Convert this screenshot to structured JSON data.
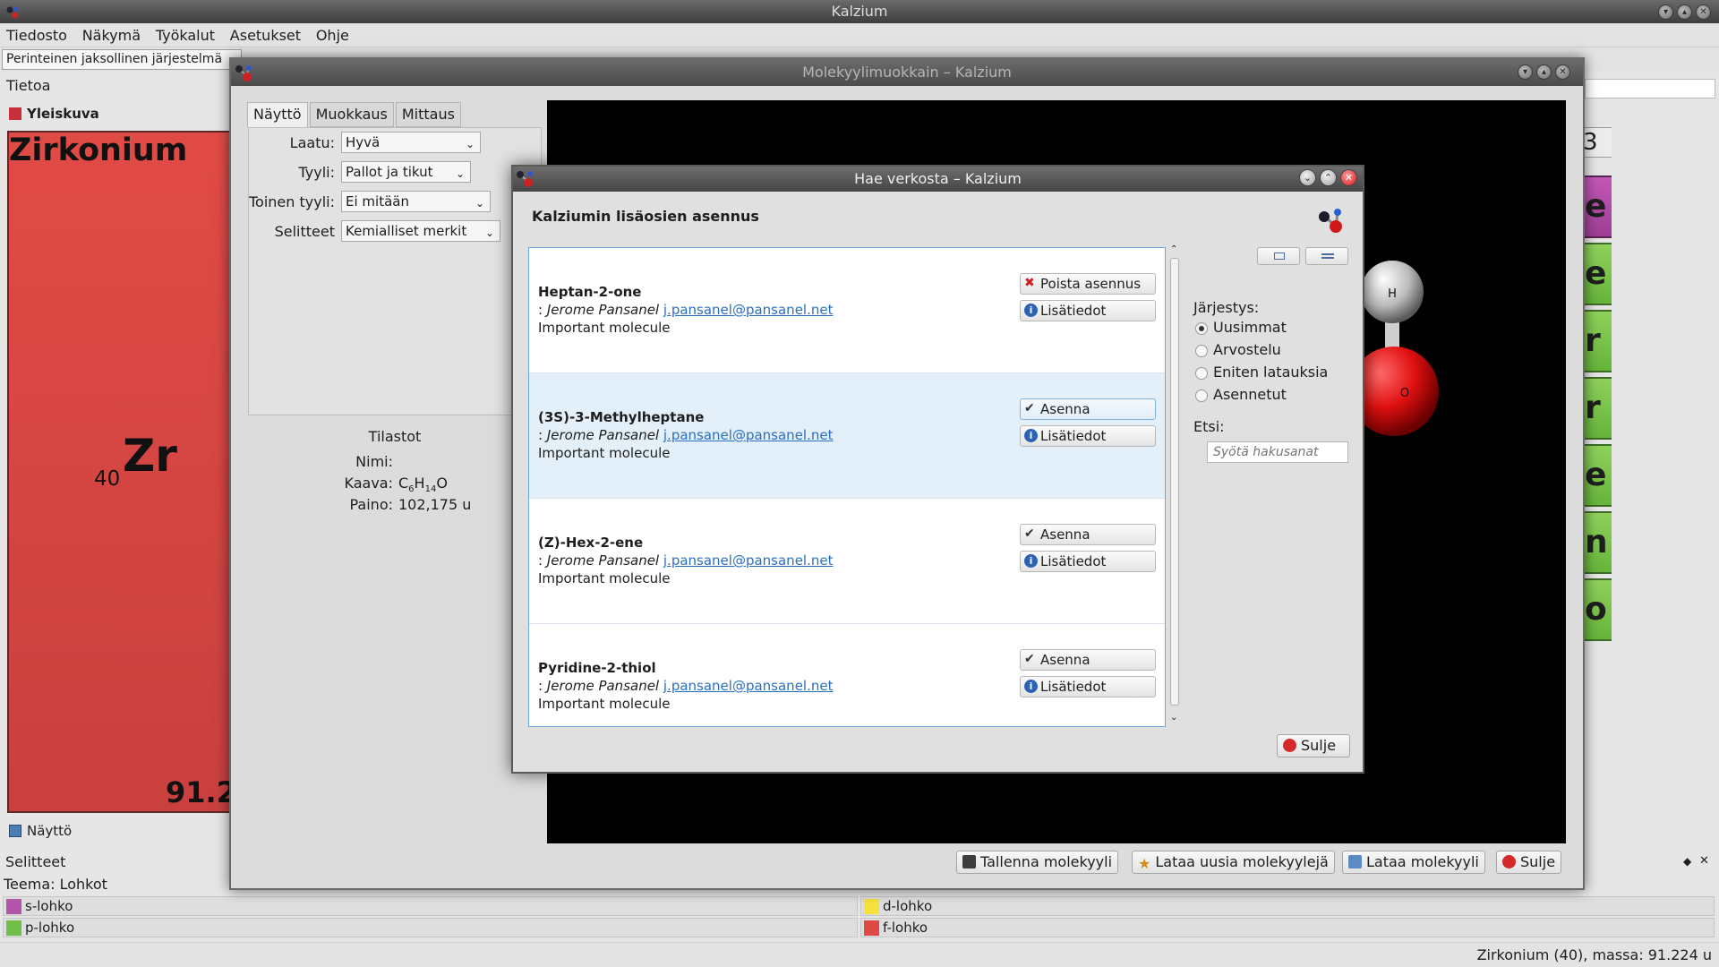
{
  "main_window": {
    "title": "Kalzium",
    "menu": [
      "Tiedosto",
      "Näkymä",
      "Työkalut",
      "Asetukset",
      "Ohje"
    ],
    "scheme_select": "Perinteinen jaksollinen järjestelmä",
    "info_header": "Tietoa",
    "overview_label": "Yleiskuva",
    "element": {
      "name": "Zirkonium",
      "number": "40",
      "symbol": "Zr",
      "mass": "91.2"
    },
    "view_dock_label": "Näyttö",
    "legend_title": "Selitteet",
    "theme_label": "Teema: Lohkot",
    "legend_items": [
      {
        "label": "s-lohko",
        "color": "#b455a9"
      },
      {
        "label": "d-lohko",
        "color": "#f5e23b"
      },
      {
        "label": "p-lohko",
        "color": "#6fbf4a"
      },
      {
        "label": "f-lohko",
        "color": "#de4a43"
      }
    ],
    "right_cells": [
      "e",
      "e",
      "r",
      "r",
      "e",
      "n",
      "o"
    ],
    "right_top_cell": "3",
    "status": "Zirkonium (40), massa: 91.224 u"
  },
  "molecule_editor": {
    "title": "Molekyylimuokkain – Kalzium",
    "tabs": [
      "Näyttö",
      "Muokkaus",
      "Mittaus"
    ],
    "fields": [
      {
        "label": "Laatu:",
        "value": "Hyvä"
      },
      {
        "label": "Tyyli:",
        "value": "Pallot ja tikut"
      },
      {
        "label": "Toinen tyyli:",
        "value": "Ei mitään"
      },
      {
        "label": "Selitteet",
        "value": "Kemialliset merkit"
      }
    ],
    "stats": {
      "title": "Tilastot",
      "name_label": "Nimi:",
      "formula_label": "Kaava:",
      "formula_c": "C",
      "formula_c_sub": "6",
      "formula_h": "H",
      "formula_h_sub": "14",
      "formula_o": "O",
      "weight_label": "Paino:",
      "weight_value": "102,175 u"
    },
    "atom_labels": {
      "hydrogen": "H",
      "oxygen": "O"
    },
    "buttons": {
      "save": "Tallenna molekyyli",
      "download_new": "Lataa uusia molekyylejä",
      "load": "Lataa molekyyli",
      "close": "Sulje"
    }
  },
  "download_dialog": {
    "title": "Hae verkosta – Kalzium",
    "heading": "Kalziumin lisäosien asennus",
    "entries": [
      {
        "name": "Heptan-2-one",
        "author_prefix": ":",
        "author": "Jerome Pansanel",
        "email": "j.pansanel@pansanel.net",
        "summary": "Important molecule",
        "primary": "Poista asennus",
        "details": "Lisätiedot"
      },
      {
        "name": "(3S)-3-Methylheptane",
        "author_prefix": ":",
        "author": "Jerome Pansanel",
        "email": "j.pansanel@pansanel.net",
        "summary": "Important molecule",
        "primary": "Asenna",
        "details": "Lisätiedot"
      },
      {
        "name": "(Z)-Hex-2-ene",
        "author_prefix": ":",
        "author": "Jerome Pansanel",
        "email": "j.pansanel@pansanel.net",
        "summary": "Important molecule",
        "primary": "Asenna",
        "details": "Lisätiedot"
      },
      {
        "name": "Pyridine-2-thiol",
        "author_prefix": ":",
        "author": "Jerome Pansanel",
        "email": "j.pansanel@pansanel.net",
        "summary": "Important molecule",
        "primary": "Asenna",
        "details": "Lisätiedot"
      }
    ],
    "sort_label": "Järjestys:",
    "sort_options": [
      "Uusimmat",
      "Arvostelu",
      "Eniten latauksia",
      "Asennetut"
    ],
    "sort_selected": "Uusimmat",
    "search_label": "Etsi:",
    "search_placeholder": "Syötä hakusanat",
    "search_value": "",
    "close": "Sulje"
  }
}
